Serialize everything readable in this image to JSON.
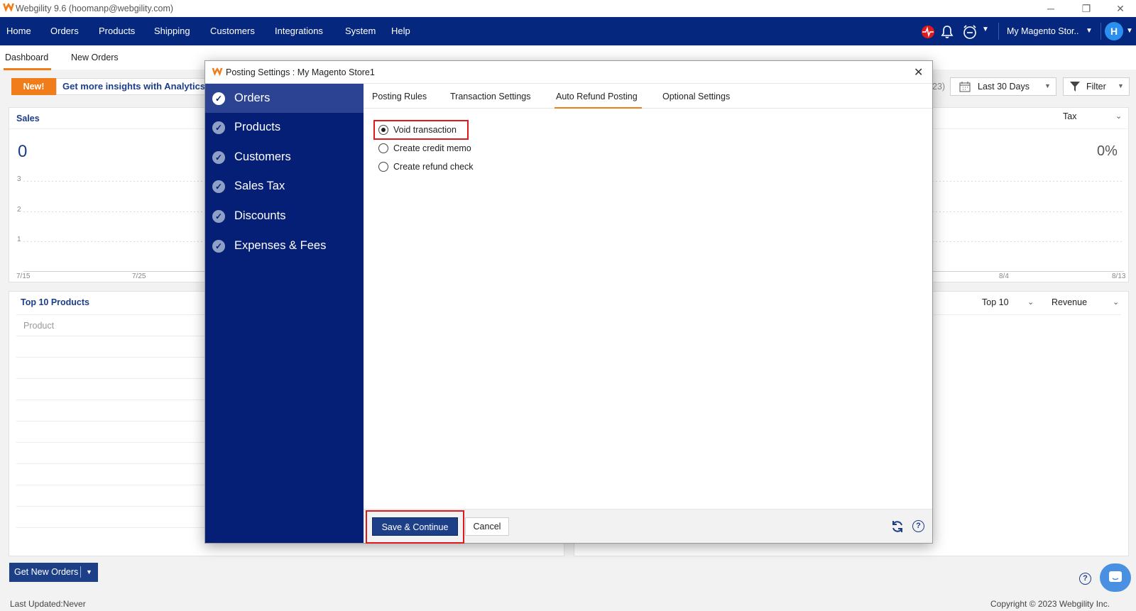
{
  "window": {
    "title": "Webgility 9.6 (hoomanp@webgility.com)",
    "minimize": "─",
    "restore": "❐",
    "close": "✕"
  },
  "nav": {
    "items": [
      "Home",
      "Orders",
      "Products",
      "Shipping",
      "Customers",
      "Integrations",
      "System",
      "Help"
    ],
    "store": "My Magento Stor..",
    "avatar": "H",
    "icons": [
      "pulse-icon",
      "bell-icon",
      "alarm-icon"
    ]
  },
  "subtabs": [
    "Dashboard",
    "New Orders"
  ],
  "banner": {
    "badge": "New!",
    "text": "Get more insights with Analytics"
  },
  "filters": {
    "range_suffix": "23)",
    "date_range": "Last 30 Days",
    "filter": "Filter"
  },
  "sales": {
    "title": "Sales",
    "value": "0",
    "percent": "0%",
    "tax_label": "Tax",
    "y_ticks": [
      "3",
      "2",
      "1"
    ],
    "x_ticks_left": [
      "7/15",
      "7/25"
    ],
    "x_ticks_right": [
      "8/4",
      "8/13"
    ]
  },
  "top_products": {
    "title": "Top 10 Products",
    "col_product": "Product",
    "top_select": "Top 10",
    "metric_select": "Revenue"
  },
  "modal": {
    "title": "Posting Settings : My Magento Store1",
    "close": "✕",
    "sidebar": [
      "Orders",
      "Products",
      "Customers",
      "Sales Tax",
      "Discounts",
      "Expenses & Fees"
    ],
    "tabs": [
      "Posting Rules",
      "Transaction Settings",
      "Auto Refund Posting",
      "Optional Settings"
    ],
    "active_tab": "Auto Refund Posting",
    "options": [
      {
        "label": "Void transaction",
        "checked": true
      },
      {
        "label": "Create credit memo",
        "checked": false
      },
      {
        "label": "Create refund check",
        "checked": false
      }
    ],
    "save": "Save & Continue",
    "cancel": "Cancel",
    "help": "?"
  },
  "bottom": {
    "get_orders": "Get New Orders",
    "last_updated": "Last Updated:Never",
    "copyright": "Copyright © 2023 Webgility Inc.",
    "help": "?"
  },
  "colors": {
    "nav": "#05287e",
    "accent": "#f07d1a",
    "sidebar": "#061f76",
    "highlight": "#e0191f",
    "button": "#1d3f88"
  }
}
